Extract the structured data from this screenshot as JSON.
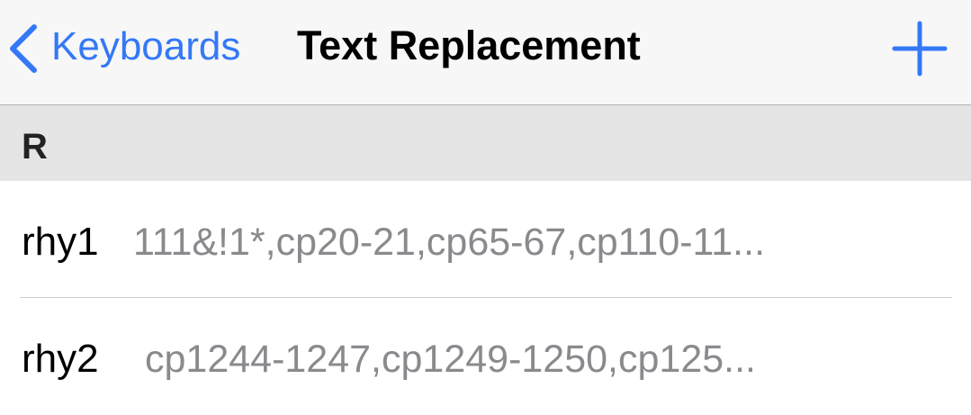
{
  "navbar": {
    "back_label": "Keyboards",
    "title": "Text Replacement",
    "add_icon": "plus-icon",
    "back_icon": "chevron-left-icon",
    "accent_color": "#3478f6"
  },
  "section": {
    "letter": "R"
  },
  "rows": [
    {
      "shortcut": "rhy1",
      "phrase": "111&!1*,cp20-21,cp65-67,cp110-11..."
    },
    {
      "shortcut": "rhy2",
      "phrase": "cp1244-1247,cp1249-1250,cp125..."
    }
  ]
}
